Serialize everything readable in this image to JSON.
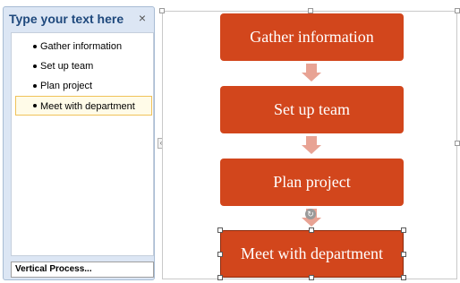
{
  "text_pane": {
    "title": "Type your text here",
    "close_symbol": "×",
    "items": [
      {
        "label": "Gather information"
      },
      {
        "label": "Set up team"
      },
      {
        "label": "Plan project"
      },
      {
        "label": "Meet with department"
      }
    ],
    "footer_label": "Vertical Process..."
  },
  "diagram": {
    "shapes": [
      {
        "label": "Gather information"
      },
      {
        "label": "Set up team"
      },
      {
        "label": "Plan project"
      },
      {
        "label": "Meet with department"
      }
    ],
    "shape_color": "#d2461c",
    "arrow_color": "#e8a394"
  }
}
